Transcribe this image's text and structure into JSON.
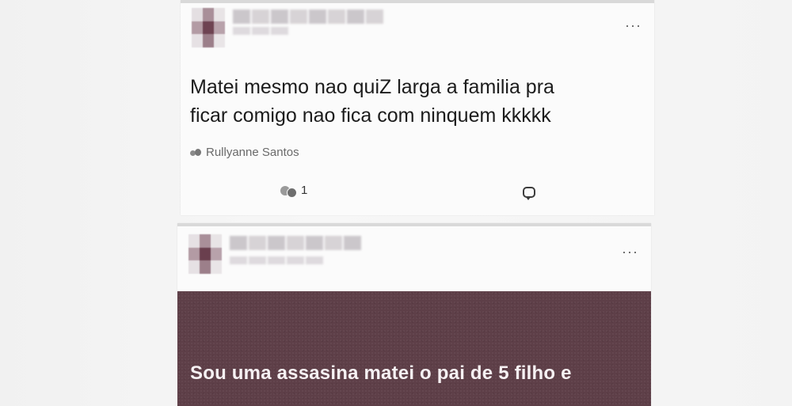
{
  "post1": {
    "text_line1": "Matei mesmo nao quiZ larga a familia pra",
    "text_line2": "ficar comigo nao fica com ninquem kkkkk",
    "tagged_name": "Rullyanne Santos",
    "reaction_count": "1",
    "more_icon": "more-options-icon",
    "comment_icon": "comment-icon"
  },
  "post2": {
    "background_text": "Sou uma assasina matei o pai de 5 filho e",
    "background_color": "#5e3f48",
    "more_icon": "more-options-icon"
  },
  "colors": {
    "card_bg": "#fbfbfb",
    "text": "#1c1c1c",
    "muted": "#6a6a6a"
  }
}
